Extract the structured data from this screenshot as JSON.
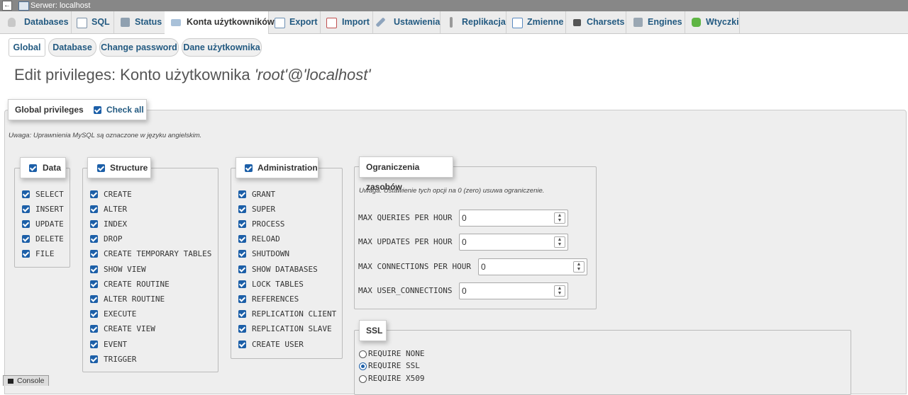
{
  "window": {
    "title": "Serwer: localhost",
    "toggle": "←"
  },
  "tabs": [
    {
      "label": "Databases",
      "icon": "database-icon",
      "active": false
    },
    {
      "label": "SQL",
      "icon": "sql-icon",
      "active": false
    },
    {
      "label": "Status",
      "icon": "status-icon",
      "active": false
    },
    {
      "label": "Konta użytkowników",
      "icon": "users-icon",
      "active": true
    },
    {
      "label": "Export",
      "icon": "export-icon",
      "active": false
    },
    {
      "label": "Import",
      "icon": "import-icon",
      "active": false
    },
    {
      "label": "Ustawienia",
      "icon": "settings-wrench-icon",
      "active": false
    },
    {
      "label": "Replikacja",
      "icon": "replication-icon",
      "active": false
    },
    {
      "label": "Zmienne",
      "icon": "variables-icon",
      "active": false
    },
    {
      "label": "Charsets",
      "icon": "charsets-icon",
      "active": false
    },
    {
      "label": "Engines",
      "icon": "engines-icon",
      "active": false
    },
    {
      "label": "Wtyczki",
      "icon": "plugins-icon",
      "active": false
    }
  ],
  "subtabs": [
    {
      "label": "Global",
      "active": true
    },
    {
      "label": "Database",
      "active": false
    },
    {
      "label": "Change password",
      "active": false
    },
    {
      "label": "Dane użytkownika",
      "active": false
    }
  ],
  "heading": {
    "prefix": "Edit privileges: Konto użytkownika ",
    "account": "'root'@'localhost'"
  },
  "global": {
    "legend": "Global privileges",
    "check_all": "Check all",
    "note": "Uwaga: Uprawnienia MySQL są oznaczone w języku angielskim."
  },
  "groups": {
    "data": {
      "legend": "Data",
      "items": [
        "SELECT",
        "INSERT",
        "UPDATE",
        "DELETE",
        "FILE"
      ]
    },
    "structure": {
      "legend": "Structure",
      "items": [
        "CREATE",
        "ALTER",
        "INDEX",
        "DROP",
        "CREATE TEMPORARY TABLES",
        "SHOW VIEW",
        "CREATE ROUTINE",
        "ALTER ROUTINE",
        "EXECUTE",
        "CREATE VIEW",
        "EVENT",
        "TRIGGER"
      ]
    },
    "administration": {
      "legend": "Administration",
      "items": [
        "GRANT",
        "SUPER",
        "PROCESS",
        "RELOAD",
        "SHUTDOWN",
        "SHOW DATABASES",
        "LOCK TABLES",
        "REFERENCES",
        "REPLICATION CLIENT",
        "REPLICATION SLAVE",
        "CREATE USER"
      ]
    }
  },
  "resources": {
    "legend": "Ograniczenia zasobów",
    "note": "Uwaga: Ustawienie tych opcji na 0 (zero) usuwa ograniczenie.",
    "fields": [
      {
        "label": "MAX QUERIES PER HOUR",
        "value": "0"
      },
      {
        "label": "MAX UPDATES PER HOUR",
        "value": "0"
      },
      {
        "label": "MAX CONNECTIONS PER HOUR",
        "value": "0"
      },
      {
        "label": "MAX USER_CONNECTIONS",
        "value": "0"
      }
    ]
  },
  "ssl": {
    "legend": "SSL",
    "options": [
      {
        "label": "REQUIRE NONE",
        "selected": false
      },
      {
        "label": "REQUIRE SSL",
        "selected": true
      },
      {
        "label": "REQUIRE X509",
        "selected": false
      }
    ]
  },
  "console": {
    "label": "Console"
  },
  "colors": {
    "link": "#235a81",
    "checkbox": "#1c5fa8",
    "panel": "#eeeeee"
  }
}
